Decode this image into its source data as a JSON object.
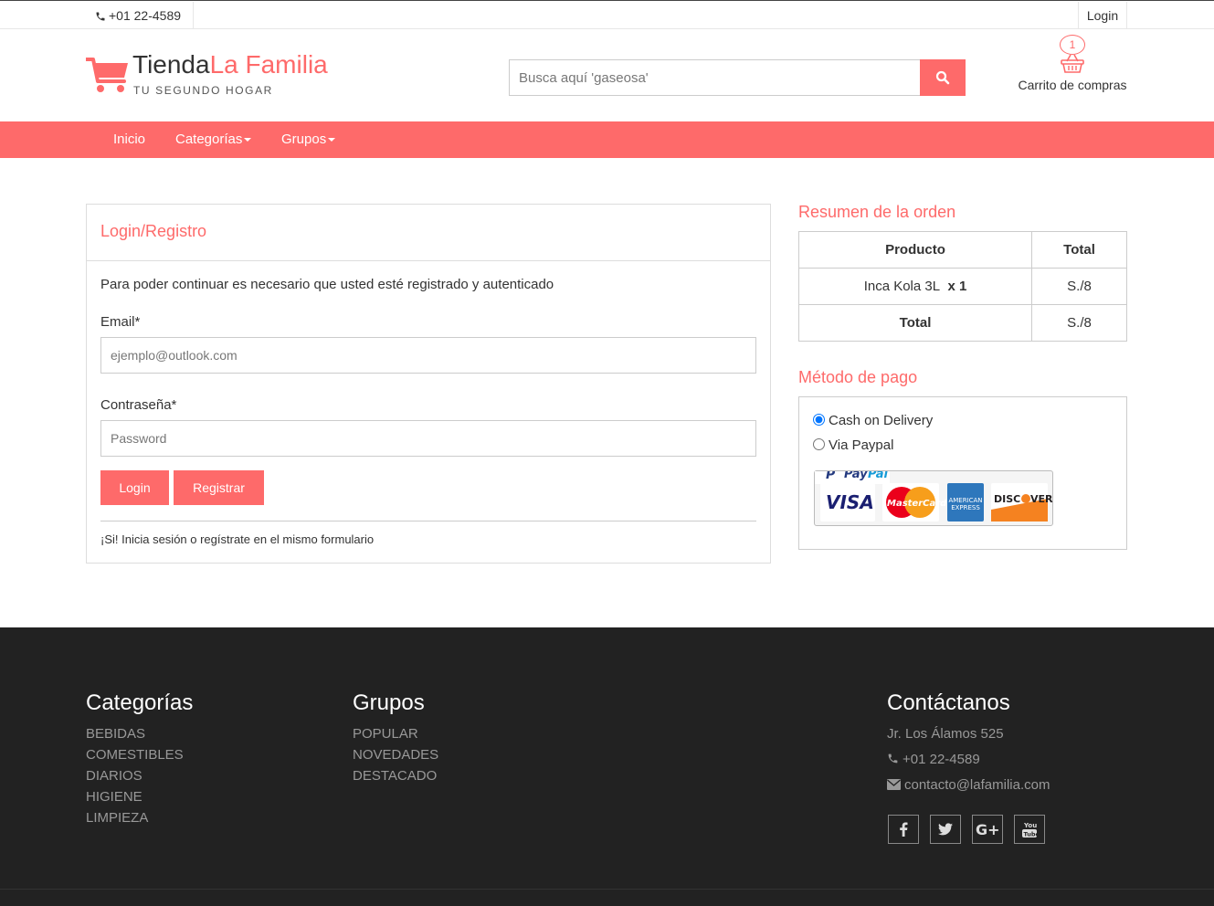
{
  "topbar": {
    "phone": "+01 22-4589",
    "login": "Login"
  },
  "brand": {
    "name_part1": "Tienda",
    "name_part2": "La Familia",
    "slogan": "TU SEGUNDO HOGAR"
  },
  "search": {
    "placeholder": "Busca aquí 'gaseosa'"
  },
  "cart": {
    "count": "1",
    "label": "Carrito de compras"
  },
  "nav": {
    "inicio": "Inicio",
    "categorias": "Categorías",
    "grupos": "Grupos"
  },
  "login_panel": {
    "title": "Login/Registro",
    "intro": "Para poder continuar es necesario que usted esté registrado y autenticado",
    "email_label": "Email*",
    "email_placeholder": "ejemplo@outlook.com",
    "password_label": "Contraseña*",
    "password_placeholder": "Password",
    "login_button": "Login",
    "register_button": "Registrar",
    "note": "¡Si! Inicia sesión o regístrate en el mismo formulario"
  },
  "order_summary": {
    "title": "Resumen de la orden",
    "headers": [
      "Producto",
      "Total"
    ],
    "product_name": "Inca Kola 3L",
    "product_qty": "x 1",
    "product_total": "S./8",
    "total_label": "Total",
    "total_value": "S./8"
  },
  "payment": {
    "title": "Método de pago",
    "option_cod": "Cash on Delivery",
    "option_paypal": "Via Paypal",
    "selected": "Cash on Delivery"
  },
  "footer": {
    "categorias_title": "Categorías",
    "categorias": [
      "BEBIDAS",
      "COMESTIBLES",
      "DIARIOS",
      "HIGIENE",
      "LIMPIEZA"
    ],
    "grupos_title": "Grupos",
    "grupos": [
      "POPULAR",
      "NOVEDADES",
      "DESTACADO"
    ],
    "contact_title": "Contáctanos",
    "address": "Jr. Los Álamos 525",
    "phone": "+01 22-4589",
    "email": "contacto@lafamilia.com",
    "social_icons": [
      "facebook-icon",
      "twitter-icon",
      "google-plus-icon",
      "youtube-icon"
    ]
  },
  "colors": {
    "accent": "#fe6a6a",
    "footer_bg": "#222222"
  }
}
